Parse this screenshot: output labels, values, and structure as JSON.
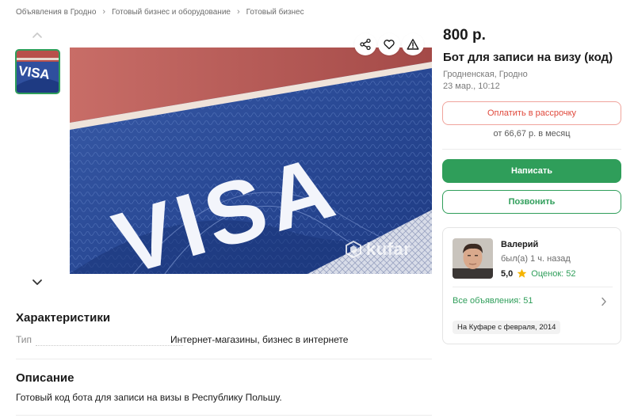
{
  "breadcrumb": {
    "items": [
      "Объявления в Гродно",
      "Готовый бизнес и оборудование",
      "Готовый бизнес"
    ],
    "separator": "›"
  },
  "gallery": {
    "image_text": "VISA",
    "watermark": "kufar"
  },
  "listing": {
    "price": "800 р.",
    "title": "Бот для записи на визу (код)",
    "location": "Гродненская, Гродно",
    "date": "23 мар., 10:12"
  },
  "actions": {
    "installment_label": "Оплатить в рассрочку",
    "installment_note": "от 66,67 р. в месяц",
    "write_label": "Написать",
    "call_label": "Позвонить"
  },
  "seller": {
    "name": "Валерий",
    "last_seen": "был(а) 1 ч. назад",
    "rating": "5,0",
    "reviews": "Оценок: 52",
    "all_ads": "Все объявления: 51",
    "since": "На Куфаре с февраля, 2014"
  },
  "characteristics": {
    "title": "Характеристики",
    "rows": [
      {
        "label": "Тип",
        "value": "Интернет-магазины, бизнес в интернете"
      }
    ]
  },
  "description": {
    "title": "Описание",
    "text": "Готовый код бота для записи на визы в Республику Польшу."
  },
  "icons": {
    "share": "share-icon",
    "favorite": "heart-icon",
    "report": "warning-icon",
    "star": "star-icon",
    "nav_up": "chevron-up-icon",
    "nav_down": "chevron-down-icon",
    "all_ads_arrow": "chevron-right-icon"
  },
  "colors": {
    "accent_green": "#2f9e5a",
    "installment_red": "#e0483b",
    "star_yellow": "#f5b400"
  }
}
